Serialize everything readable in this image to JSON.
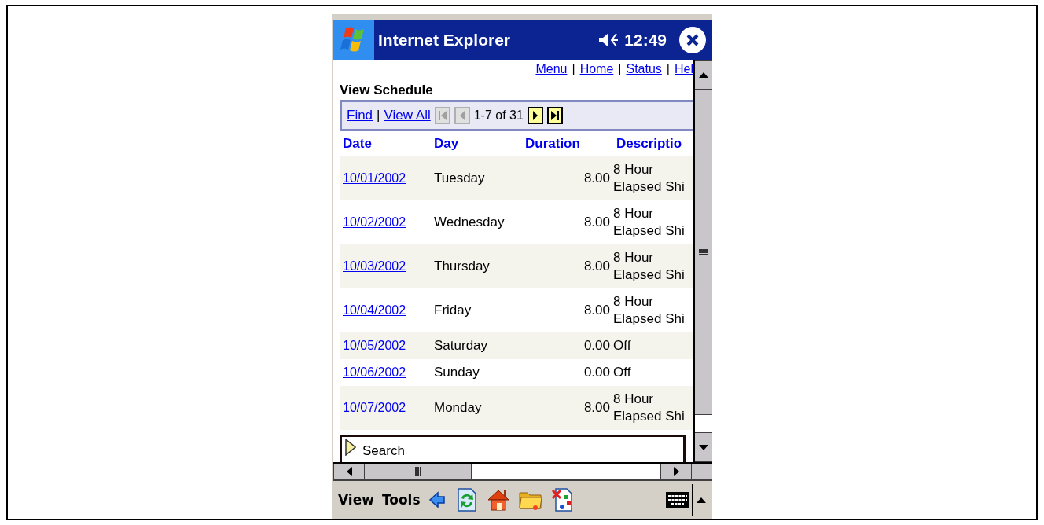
{
  "title_bar": {
    "app_name": "Internet Explorer",
    "time": "12:49"
  },
  "top_links": {
    "items": [
      "Menu",
      "Home",
      "Status",
      "Hel"
    ],
    "separator": "|"
  },
  "page_title": "View Schedule",
  "pager": {
    "links": [
      "Find",
      "View All"
    ],
    "separator": "|",
    "range": "1-7 of 31",
    "buttons": [
      {
        "kind": "first",
        "disabled": true
      },
      {
        "kind": "prev",
        "disabled": true
      },
      {
        "kind": "next",
        "disabled": false
      },
      {
        "kind": "last",
        "disabled": false
      }
    ]
  },
  "table": {
    "columns": [
      "Date",
      "Day",
      "Duration",
      "Descriptio"
    ],
    "rows": [
      {
        "date": "10/01/2002",
        "day": "Tuesday",
        "duration": "8.00",
        "description": "8 Hour Elapsed Shi"
      },
      {
        "date": "10/02/2002",
        "day": "Wednesday",
        "duration": "8.00",
        "description": "8 Hour Elapsed Shi"
      },
      {
        "date": "10/03/2002",
        "day": "Thursday",
        "duration": "8.00",
        "description": "8 Hour Elapsed Shi"
      },
      {
        "date": "10/04/2002",
        "day": "Friday",
        "duration": "8.00",
        "description": "8 Hour Elapsed Shi"
      },
      {
        "date": "10/05/2002",
        "day": "Saturday",
        "duration": "0.00",
        "description": "Off"
      },
      {
        "date": "10/06/2002",
        "day": "Sunday",
        "duration": "0.00",
        "description": "Off"
      },
      {
        "date": "10/07/2002",
        "day": "Monday",
        "duration": "8.00",
        "description": "8 Hour Elapsed Shi"
      }
    ]
  },
  "search_bar": {
    "label": "Search"
  },
  "menu_bar": {
    "items": [
      "View",
      "Tools"
    ]
  }
}
